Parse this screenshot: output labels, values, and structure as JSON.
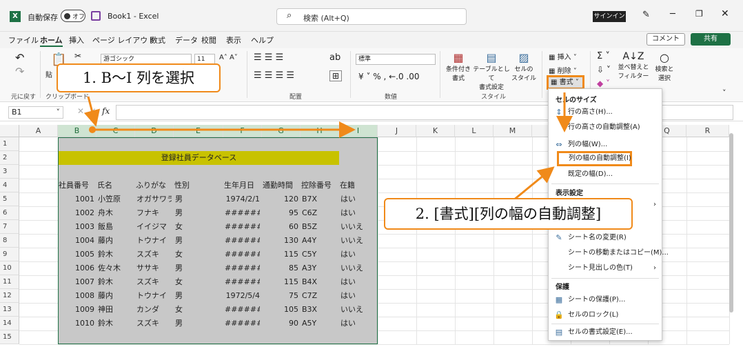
{
  "titlebar": {
    "autosave": "自動保存",
    "toggle": "オフ",
    "title": "Book1 - Excel",
    "search": "検索 (Alt+Q)",
    "signin": "サインイン"
  },
  "menus": [
    "ファイル",
    "ホーム",
    "挿入",
    "ページ レイアウト",
    "数式",
    "データ",
    "校閲",
    "表示",
    "ヘルプ"
  ],
  "actions": {
    "comment": "コメント",
    "share": "共有"
  },
  "ribbon": {
    "undo_group": "元に戻す",
    "clip_group": "クリップボード",
    "paste": "貼",
    "font_name": "游ゴシック",
    "font_size": "11",
    "align_group": "配置",
    "number_format": "標準",
    "number_group": "数値",
    "style_group": "スタイル",
    "cond": "条件付き\n書式",
    "table": "テーブルとして\n書式設定",
    "cellstyle": "セルの\nスタイル",
    "insert": "挿入",
    "delete": "削除",
    "format": "書式",
    "sort": "並べ替えと\nフィルター",
    "find": "検索と\n選択"
  },
  "formula": {
    "namebox": "B1",
    "fx": "fx"
  },
  "columns": [
    "A",
    "B",
    "C",
    "D",
    "E",
    "F",
    "G",
    "H",
    "I",
    "J",
    "K",
    "L",
    "M",
    "N",
    "O",
    "P",
    "Q",
    "R"
  ],
  "rows": [
    "1",
    "2",
    "3",
    "4",
    "5",
    "6",
    "7",
    "8",
    "9",
    "10",
    "11",
    "12",
    "13",
    "14",
    "15"
  ],
  "sheet_title": "登録社員データベース",
  "headers": [
    "社員番号",
    "氏名",
    "ふりがな",
    "性別",
    "生年月日",
    "通勤時間",
    "控除番号",
    "在籍"
  ],
  "records": [
    [
      "1001",
      "小笠原",
      "オガサワラ",
      "男",
      "1974/2/1",
      "120",
      "B7X",
      "はい"
    ],
    [
      "1002",
      "舟木",
      "フナキ",
      "男",
      "#######",
      "95",
      "C6Z",
      "はい"
    ],
    [
      "1003",
      "飯島",
      "イイジマ",
      "女",
      "#######",
      "60",
      "B5Z",
      "いいえ"
    ],
    [
      "1004",
      "藤内",
      "トウナイ",
      "男",
      "#######",
      "130",
      "A4Y",
      "いいえ"
    ],
    [
      "1005",
      "鈴木",
      "スズキ",
      "女",
      "#######",
      "115",
      "C5Y",
      "はい"
    ],
    [
      "1006",
      "佐々木",
      "ササキ",
      "男",
      "#######",
      "85",
      "A3Y",
      "いいえ"
    ],
    [
      "1007",
      "鈴木",
      "スズキ",
      "女",
      "#######",
      "115",
      "B4X",
      "はい"
    ],
    [
      "1008",
      "藤内",
      "トウナイ",
      "男",
      "1972/5/4",
      "75",
      "C7Z",
      "はい"
    ],
    [
      "1009",
      "神田",
      "カンダ",
      "女",
      "#######",
      "105",
      "B3X",
      "いいえ"
    ],
    [
      "1010",
      "鈴木",
      "スズキ",
      "男",
      "#######",
      "90",
      "A5Y",
      "はい"
    ]
  ],
  "dropdown": {
    "h_size": "セルのサイズ",
    "row_height": "行の高さ(H)...",
    "row_auto": "行の高さの自動調整(A)",
    "col_width": "列の幅(W)...",
    "col_auto": "列の幅の自動調整(I)",
    "default_width": "既定の幅(D)...",
    "h_visibility": "表示設定",
    "rename": "シート名の変更(R)",
    "move": "シートの移動またはコピー(M)...",
    "tabcolor": "シート見出しの色(T)",
    "h_protect": "保護",
    "protect": "シートの保護(P)...",
    "lock": "セルのロック(L)",
    "format_cells": "セルの書式設定(E)..."
  },
  "callouts": {
    "step1": "1. B～I 列を選択",
    "step2": "2. [書式][列の幅の自動調整]"
  },
  "colors": {
    "excel_green": "#1e7145",
    "selection": "#c8c8c8",
    "title_band": "#c8c200",
    "callout": "#f08a1a"
  }
}
